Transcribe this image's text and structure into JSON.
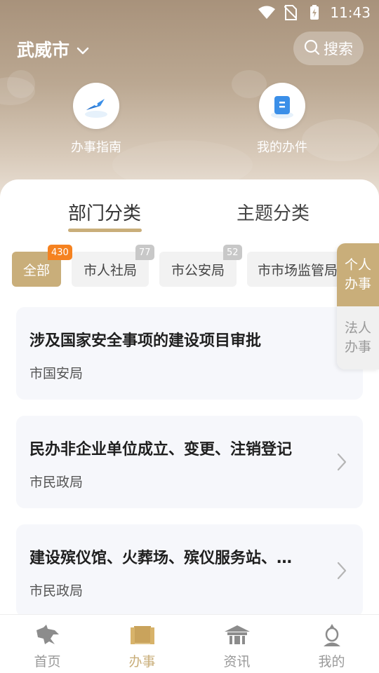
{
  "status_bar": {
    "time": "11:43"
  },
  "header": {
    "city": "武威市",
    "search_label": "搜索",
    "quick_actions": [
      {
        "label": "办事指南",
        "icon": "compass-icon"
      },
      {
        "label": "我的办件",
        "icon": "document-icon"
      }
    ]
  },
  "tabs": [
    {
      "label": "部门分类",
      "active": true
    },
    {
      "label": "主题分类",
      "active": false
    }
  ],
  "categories": [
    {
      "label": "全部",
      "count": "430",
      "active": true
    },
    {
      "label": "市人社局",
      "count": "77",
      "active": false
    },
    {
      "label": "市公安局",
      "count": "52",
      "active": false
    },
    {
      "label": "市市场监管局",
      "count": "",
      "active": false
    }
  ],
  "side_tabs": [
    {
      "label": "个人办事",
      "active": true
    },
    {
      "label": "法人办事",
      "active": false
    }
  ],
  "items": [
    {
      "title": "涉及国家安全事项的建设项目审批",
      "dept": "市国安局",
      "has_arrow": false
    },
    {
      "title": "民办非企业单位成立、变更、注销登记",
      "dept": "市民政局",
      "has_arrow": true
    },
    {
      "title": "建设殡仪馆、火葬场、殡仪服务站、…",
      "dept": "市民政局",
      "has_arrow": true
    }
  ],
  "bottom_nav": [
    {
      "label": "首页",
      "icon": "horse-icon",
      "active": false
    },
    {
      "label": "办事",
      "icon": "book-icon",
      "active": true
    },
    {
      "label": "资讯",
      "icon": "pavilion-icon",
      "active": false
    },
    {
      "label": "我的",
      "icon": "statue-icon",
      "active": false
    }
  ],
  "colors": {
    "accent": "#c9ae7a",
    "badge_orange": "#f58220"
  }
}
